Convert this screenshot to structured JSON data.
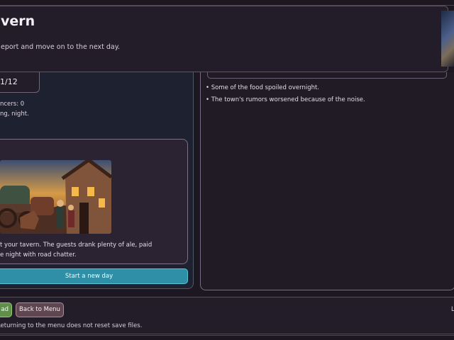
{
  "header": {
    "title": "vern",
    "subtitle": "eport and move on to the next day."
  },
  "status": {
    "day": "1/12",
    "dancers": "ncers: 0",
    "time": "ng, night."
  },
  "event": {
    "line1": "t your tavern. The guests drank plenty of ale, paid",
    "line2": "e night with road chatter.",
    "start_day_label": "Start a new day"
  },
  "report": {
    "items": [
      "• Some of the food spoiled overnight.",
      "• The town's rumors worsened because of the noise."
    ]
  },
  "footer": {
    "load_label": "ad",
    "menu_label": "Back to Menu",
    "note": "Returning to the menu does not reset save files.",
    "edge_text": "L"
  },
  "colors": {
    "background": "#1c1720",
    "panel": "#231d29",
    "accent_button": "#2f8fa6",
    "load_button": "#5f8f48",
    "menu_button": "#5f4650"
  }
}
